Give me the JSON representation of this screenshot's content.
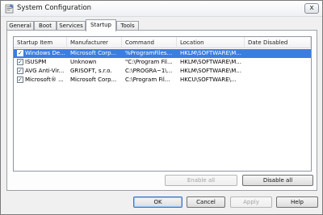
{
  "window": {
    "title": "System Configuration",
    "close_glyph": "x"
  },
  "tabs": [
    {
      "label": "General"
    },
    {
      "label": "Boot"
    },
    {
      "label": "Services"
    },
    {
      "label": "Startup",
      "active": true
    },
    {
      "label": "Tools"
    }
  ],
  "startup_list": {
    "columns": [
      "Startup Item",
      "Manufacturer",
      "Command",
      "Location",
      "Date Disabled"
    ],
    "rows": [
      {
        "checked": true,
        "selected": true,
        "item": "Windows De...",
        "manufacturer": "Microsoft Corp...",
        "command": "%ProgramFiles...",
        "location": "HKLM\\SOFTWARE\\M...",
        "date_disabled": ""
      },
      {
        "checked": true,
        "selected": false,
        "item": "ISUSPM",
        "manufacturer": "Unknown",
        "command": "\"C:\\Program Fil...",
        "location": "HKLM\\SOFTWARE\\M...",
        "date_disabled": ""
      },
      {
        "checked": true,
        "selected": false,
        "item": "AVG Anti-Vir...",
        "manufacturer": "GRISOFT, s.r.o.",
        "command": "C:\\PROGRA~1\\...",
        "location": "HKLM\\SOFTWARE\\M...",
        "date_disabled": ""
      },
      {
        "checked": true,
        "selected": false,
        "item": "Microsoft® ...",
        "manufacturer": "Microsoft Corp...",
        "command": "C:\\Program Fil...",
        "location": "HKCU\\SOFTWARE\\...",
        "date_disabled": ""
      }
    ]
  },
  "buttons": {
    "enable_all": "Enable all",
    "disable_all": "Disable all",
    "ok": "OK",
    "cancel": "Cancel",
    "apply": "Apply",
    "help": "Help"
  },
  "colors": {
    "selection": "#3b7de1",
    "window_bg": "#f0f0f0"
  }
}
